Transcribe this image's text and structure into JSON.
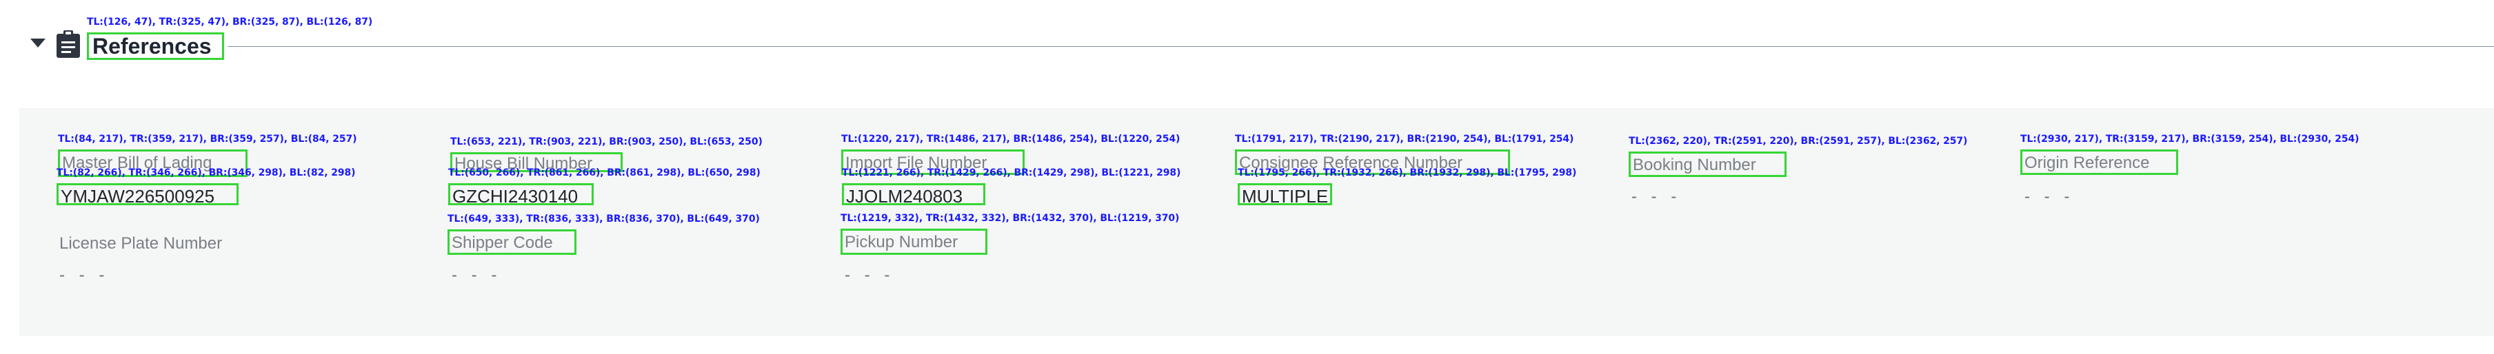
{
  "section": {
    "title": "References",
    "title_annotation": "TL:(126, 47), TR:(325, 47), BR:(325, 87), BL:(126, 87)"
  },
  "fields": {
    "mbl": {
      "label": "Master Bill of Lading",
      "value": "YMJAW226500925",
      "label_annotation": "TL:(84, 217), TR:(359, 217), BR:(359, 257), BL:(84, 257)",
      "value_annotation": "TL:(82, 266), TR:(346, 266), BR:(346, 298), BL:(82, 298)"
    },
    "license_plate": {
      "label": "License Plate Number",
      "value": "- - -"
    },
    "hbl": {
      "label": "House Bill Number",
      "value": "GZCHI2430140",
      "label_annotation": "TL:(653, 221), TR:(903, 221), BR:(903, 250), BL:(653, 250)",
      "value_annotation": "TL:(650, 266), TR:(861, 266), BR:(861, 298), BL:(650, 298)"
    },
    "shipper_code": {
      "label": "Shipper Code",
      "value": "- - -",
      "label_annotation": "TL:(649, 333), TR:(836, 333), BR:(836, 370), BL:(649, 370)"
    },
    "import_file": {
      "label": "Import File Number",
      "value": "JJOLM240803",
      "label_annotation": "TL:(1220, 217), TR:(1486, 217), BR:(1486, 254), BL:(1220, 254)",
      "value_annotation": "TL:(1221, 266), TR:(1429, 266), BR:(1429, 298), BL:(1221, 298)"
    },
    "pickup": {
      "label": "Pickup Number",
      "value": "- - -",
      "label_annotation": "TL:(1219, 332), TR:(1432, 332), BR:(1432, 370), BL:(1219, 370)"
    },
    "consignee_ref": {
      "label": "Consignee Reference Number",
      "value": "MULTIPLE",
      "label_annotation": "TL:(1791, 217), TR:(2190, 217), BR:(2190, 254), BL:(1791, 254)",
      "value_annotation": "TL:(1795, 266), TR:(1932, 266), BR:(1932, 298), BL:(1795, 298)"
    },
    "booking": {
      "label": "Booking Number",
      "value": "- - -",
      "label_annotation": "TL:(2362, 220), TR:(2591, 220), BR:(2591, 257), BL:(2362, 257)"
    },
    "origin_ref": {
      "label": "Origin Reference",
      "value": "- - -",
      "label_annotation": "TL:(2930, 217), TR:(3159, 217), BR:(3159, 254), BL:(2930, 254)"
    }
  },
  "colors": {
    "highlight_box": "#36d636",
    "annotation_text": "#1a1aff",
    "panel_bg": "#f5f6f6"
  },
  "icons": {
    "toggle": "caret-down-icon",
    "section": "clipboard-icon"
  }
}
